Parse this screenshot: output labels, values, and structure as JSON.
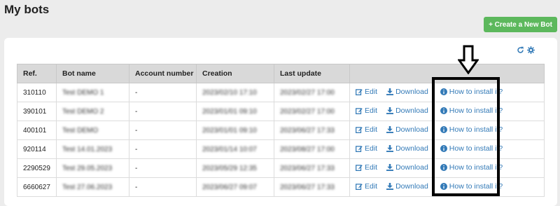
{
  "page": {
    "title": "My bots"
  },
  "toolbar": {
    "create_label": "+ Create a New Bot"
  },
  "table": {
    "headers": [
      "Ref.",
      "Bot name",
      "Account number",
      "Creation",
      "Last update",
      ""
    ],
    "rows": [
      {
        "ref": "310110",
        "name": "Test DEMO 1",
        "account": "-",
        "creation": "2023/02/10 17:10",
        "last_update": "2023/02/27 17:00"
      },
      {
        "ref": "390101",
        "name": "Test DEMO 2",
        "account": "-",
        "creation": "2023/01/01 09:10",
        "last_update": "2023/02/27 17:00"
      },
      {
        "ref": "400101",
        "name": "Test DEMO",
        "account": "-",
        "creation": "2023/01/01 09:10",
        "last_update": "2023/06/27 17:33"
      },
      {
        "ref": "920114",
        "name": "Test 14.01.2023",
        "account": "-",
        "creation": "2023/01/14 10:07",
        "last_update": "2023/08/27 17:00"
      },
      {
        "ref": "2290529",
        "name": "Test 29.05.2023",
        "account": "-",
        "creation": "2023/05/29 12:35",
        "last_update": "2023/06/27 17:33"
      },
      {
        "ref": "6660627",
        "name": "Test 27.06.2023",
        "account": "-",
        "creation": "2023/06/27 09:07",
        "last_update": "2023/06/27 17:33"
      }
    ],
    "actions": {
      "edit": "Edit",
      "download": "Download",
      "install": "How to install it?"
    }
  },
  "colors": {
    "accent": "#337ab7",
    "create_button": "#5cb85c",
    "header_bg": "#d9d9d9"
  },
  "icons": [
    "refresh-icon",
    "gear-icon",
    "edit-icon",
    "download-icon",
    "info-icon",
    "down-arrow-icon"
  ]
}
